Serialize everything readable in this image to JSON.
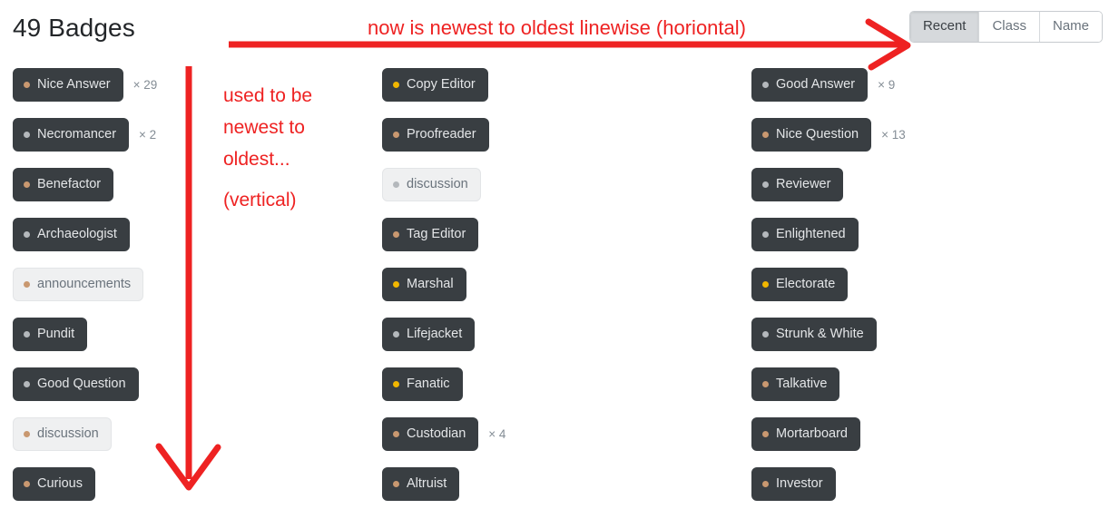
{
  "header": {
    "title": "49 Badges"
  },
  "filters": {
    "options": [
      {
        "label": "Recent",
        "selected": true
      },
      {
        "label": "Class",
        "selected": false
      },
      {
        "label": "Name",
        "selected": false
      }
    ]
  },
  "badge_colors": {
    "gold": "#f1b600",
    "silver": "#b4b8bc",
    "bronze": "#c99870",
    "dark_bg": "#393e42",
    "light_bg": "#eff0f1",
    "annotation_red": "#ee2222"
  },
  "columns": [
    {
      "name": "column-1",
      "badges": [
        {
          "label": "Nice Answer",
          "tier": "bronze",
          "theme": "dark",
          "count": "× 29"
        },
        {
          "label": "Necromancer",
          "tier": "silver",
          "theme": "dark",
          "count": "× 2"
        },
        {
          "label": "Benefactor",
          "tier": "bronze",
          "theme": "dark",
          "count": ""
        },
        {
          "label": "Archaeologist",
          "tier": "silver",
          "theme": "dark",
          "count": ""
        },
        {
          "label": "announcements",
          "tier": "bronze",
          "theme": "light",
          "count": ""
        },
        {
          "label": "Pundit",
          "tier": "silver",
          "theme": "dark",
          "count": ""
        },
        {
          "label": "Good Question",
          "tier": "silver",
          "theme": "dark",
          "count": ""
        },
        {
          "label": "discussion",
          "tier": "bronze",
          "theme": "light",
          "count": ""
        },
        {
          "label": "Curious",
          "tier": "bronze",
          "theme": "dark",
          "count": ""
        }
      ]
    },
    {
      "name": "column-2",
      "badges": [
        {
          "label": "Copy Editor",
          "tier": "gold",
          "theme": "dark",
          "count": ""
        },
        {
          "label": "Proofreader",
          "tier": "bronze",
          "theme": "dark",
          "count": ""
        },
        {
          "label": "discussion",
          "tier": "silver",
          "theme": "light",
          "count": ""
        },
        {
          "label": "Tag Editor",
          "tier": "bronze",
          "theme": "dark",
          "count": ""
        },
        {
          "label": "Marshal",
          "tier": "gold",
          "theme": "dark",
          "count": ""
        },
        {
          "label": "Lifejacket",
          "tier": "silver",
          "theme": "dark",
          "count": ""
        },
        {
          "label": "Fanatic",
          "tier": "gold",
          "theme": "dark",
          "count": ""
        },
        {
          "label": "Custodian",
          "tier": "bronze",
          "theme": "dark",
          "count": "× 4"
        },
        {
          "label": "Altruist",
          "tier": "bronze",
          "theme": "dark",
          "count": ""
        }
      ]
    },
    {
      "name": "column-3",
      "badges": [
        {
          "label": "Good Answer",
          "tier": "silver",
          "theme": "dark",
          "count": "× 9"
        },
        {
          "label": "Nice Question",
          "tier": "bronze",
          "theme": "dark",
          "count": "× 13"
        },
        {
          "label": "Reviewer",
          "tier": "silver",
          "theme": "dark",
          "count": ""
        },
        {
          "label": "Enlightened",
          "tier": "silver",
          "theme": "dark",
          "count": ""
        },
        {
          "label": "Electorate",
          "tier": "gold",
          "theme": "dark",
          "count": ""
        },
        {
          "label": "Strunk & White",
          "tier": "silver",
          "theme": "dark",
          "count": ""
        },
        {
          "label": "Talkative",
          "tier": "bronze",
          "theme": "dark",
          "count": ""
        },
        {
          "label": "Mortarboard",
          "tier": "bronze",
          "theme": "dark",
          "count": ""
        },
        {
          "label": "Investor",
          "tier": "bronze",
          "theme": "dark",
          "count": ""
        }
      ]
    }
  ],
  "annotations": {
    "top_note": "now is newest to oldest linewise (horiontal)",
    "side_note_line1": "used to be",
    "side_note_line2": "newest to",
    "side_note_line3": "oldest...",
    "side_note_line4": "(vertical)"
  }
}
